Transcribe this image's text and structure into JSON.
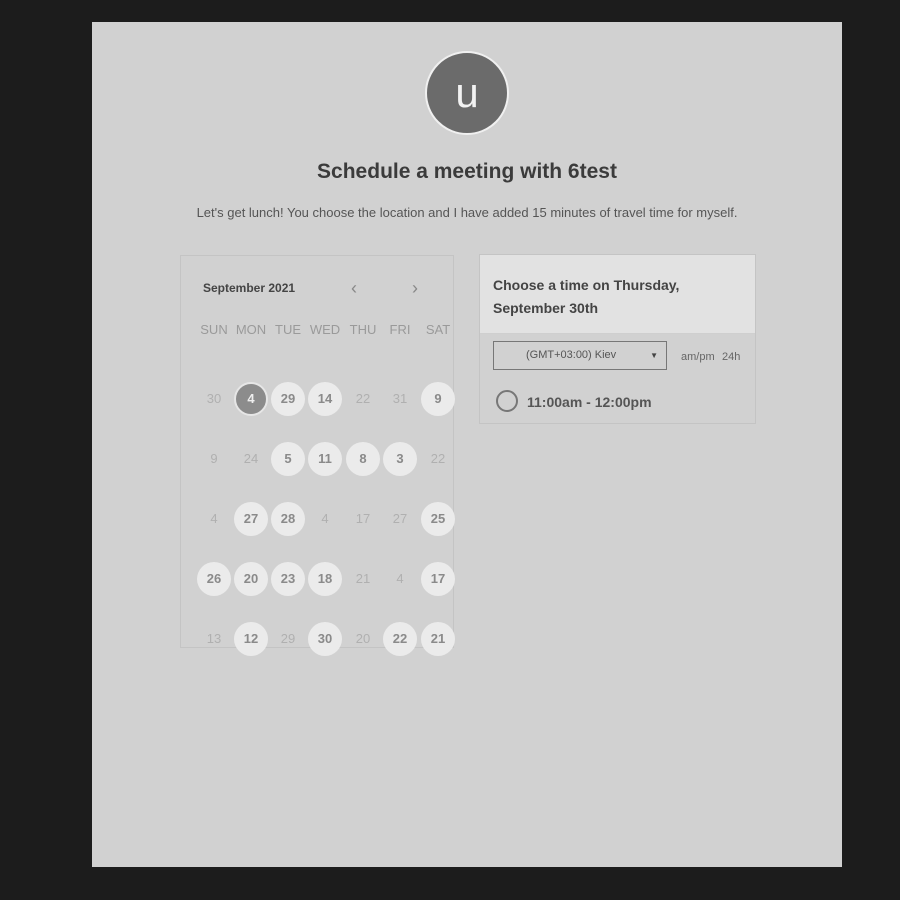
{
  "header": {
    "avatar_letter": "u",
    "title": "Schedule a meeting with 6test",
    "description": "Let's get lunch! You choose the location and I have added 15 minutes of travel time for myself."
  },
  "calendar": {
    "month_label": "September 2021",
    "prev_icon": "chevron-left-icon",
    "next_icon": "chevron-right-icon",
    "prev_glyph": "‹",
    "next_glyph": "›",
    "weekdays": [
      "SUN",
      "MON",
      "TUE",
      "WED",
      "THU",
      "FRI",
      "SAT"
    ],
    "weeks": [
      [
        {
          "d": "30",
          "a": false
        },
        {
          "d": "4",
          "a": true,
          "s": true
        },
        {
          "d": "29",
          "a": true
        },
        {
          "d": "14",
          "a": true
        },
        {
          "d": "22",
          "a": false
        },
        {
          "d": "31",
          "a": false
        },
        {
          "d": "9",
          "a": true
        }
      ],
      [
        {
          "d": "9",
          "a": false
        },
        {
          "d": "24",
          "a": false
        },
        {
          "d": "5",
          "a": true
        },
        {
          "d": "11",
          "a": true
        },
        {
          "d": "8",
          "a": true
        },
        {
          "d": "3",
          "a": true
        },
        {
          "d": "22",
          "a": false
        }
      ],
      [
        {
          "d": "4",
          "a": false
        },
        {
          "d": "27",
          "a": true
        },
        {
          "d": "28",
          "a": true
        },
        {
          "d": "4",
          "a": false
        },
        {
          "d": "17",
          "a": false
        },
        {
          "d": "27",
          "a": false
        },
        {
          "d": "25",
          "a": true
        }
      ],
      [
        {
          "d": "26",
          "a": true
        },
        {
          "d": "20",
          "a": true
        },
        {
          "d": "23",
          "a": true
        },
        {
          "d": "18",
          "a": true
        },
        {
          "d": "21",
          "a": false
        },
        {
          "d": "4",
          "a": false
        },
        {
          "d": "17",
          "a": true
        }
      ],
      [
        {
          "d": "13",
          "a": false
        },
        {
          "d": "12",
          "a": true
        },
        {
          "d": "29",
          "a": false
        },
        {
          "d": "30",
          "a": true
        },
        {
          "d": "20",
          "a": false
        },
        {
          "d": "22",
          "a": true
        },
        {
          "d": "21",
          "a": true
        }
      ]
    ]
  },
  "time_panel": {
    "heading": "Choose a time on Thursday, September 30th",
    "timezone": "(GMT+03:00) Kiev",
    "format_ampm": "am/pm",
    "format_24h": "24h",
    "slots": [
      "11:00am - 12:00pm"
    ]
  },
  "colors": {
    "page_bg": "#d1d1d1",
    "outer_bg": "#1c1c1c",
    "avatar": "#6b6b6b",
    "available_day": "#ebebeb",
    "selected_day": "#8c8c8c"
  }
}
